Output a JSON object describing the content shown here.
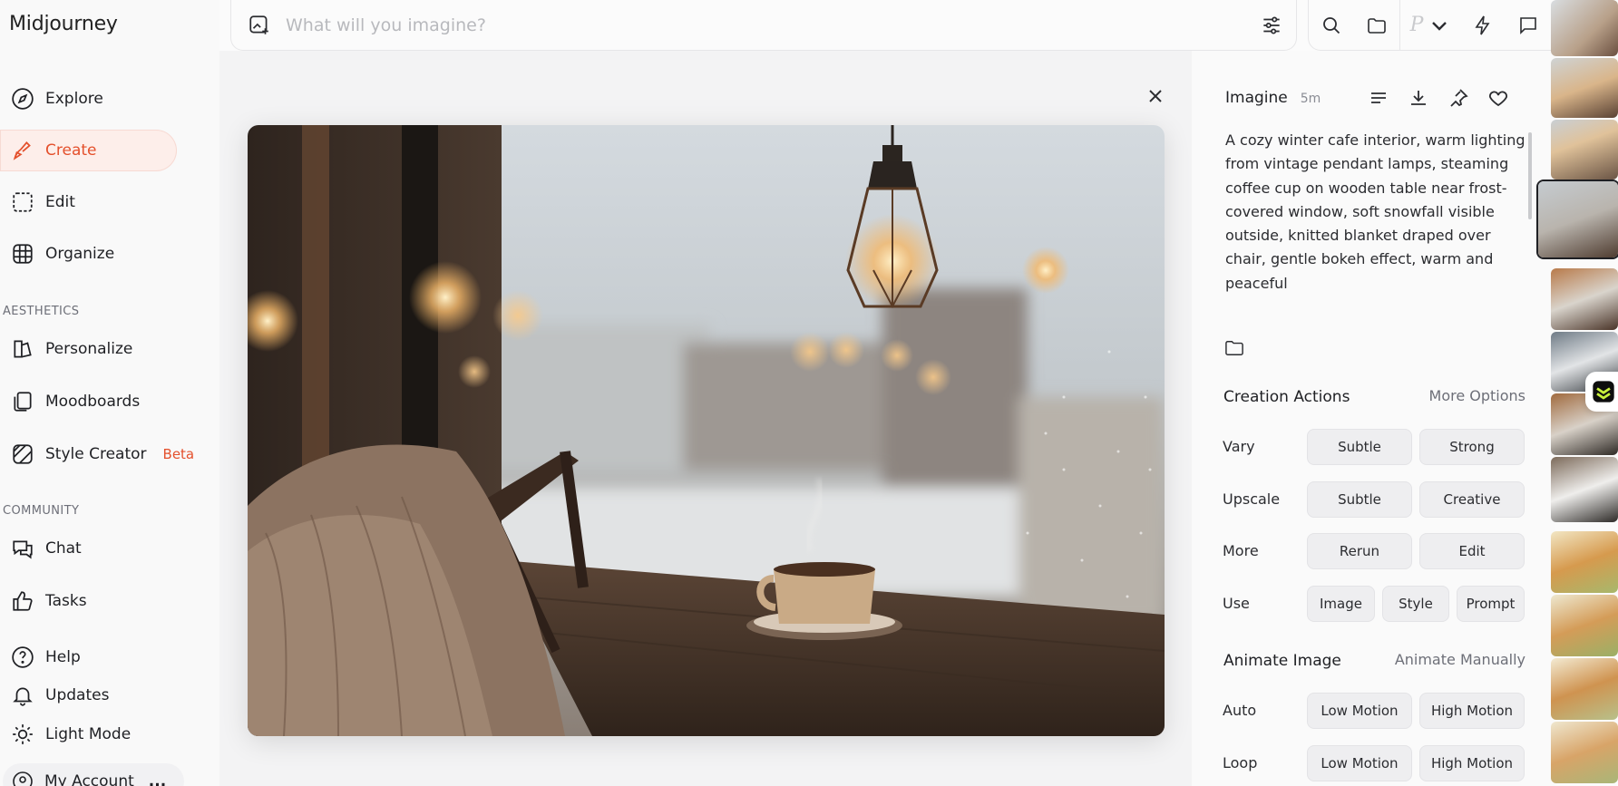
{
  "app": {
    "name": "Midjourney"
  },
  "sidebar": {
    "items": [
      {
        "label": "Explore",
        "icon": "compass-icon"
      },
      {
        "label": "Create",
        "icon": "brush-icon",
        "active": true
      },
      {
        "label": "Edit",
        "icon": "edit-selection-icon"
      },
      {
        "label": "Organize",
        "icon": "grid-icon"
      }
    ],
    "aesthetics_label": "AESTHETICS",
    "aesthetics_items": [
      {
        "label": "Personalize",
        "icon": "personalize-icon"
      },
      {
        "label": "Moodboards",
        "icon": "moodboards-icon"
      },
      {
        "label": "Style Creator",
        "icon": "style-creator-icon",
        "badge": "Beta"
      }
    ],
    "community_label": "COMMUNITY",
    "community_items": [
      {
        "label": "Chat",
        "icon": "chat-icon"
      },
      {
        "label": "Tasks",
        "icon": "thumbs-up-icon"
      }
    ],
    "bottom_items": [
      {
        "label": "Help",
        "icon": "help-icon"
      },
      {
        "label": "Updates",
        "icon": "bell-icon"
      },
      {
        "label": "Light Mode",
        "icon": "sun-icon"
      }
    ],
    "account_label": "My Account",
    "account_more": "..."
  },
  "search": {
    "placeholder": "What will you imagine?"
  },
  "topbar": {
    "profile_letter": "P"
  },
  "panel": {
    "title": "Imagine",
    "time": "5m",
    "prompt": "A cozy winter cafe interior, warm lighting from vintage pendant lamps, steaming coffee cup on wooden table near frost-covered window, soft snowfall visible outside, knitted blanket draped over chair, gentle bokeh effect, warm and peaceful",
    "creation_actions": {
      "title": "Creation Actions",
      "link": "More Options"
    },
    "rows": {
      "vary": {
        "label": "Vary",
        "buttons": [
          "Subtle",
          "Strong"
        ]
      },
      "upscale": {
        "label": "Upscale",
        "buttons": [
          "Subtle",
          "Creative"
        ]
      },
      "more": {
        "label": "More",
        "buttons": [
          "Rerun",
          "Edit"
        ]
      },
      "use": {
        "label": "Use",
        "buttons": [
          "Image",
          "Style",
          "Prompt"
        ]
      }
    },
    "animate": {
      "title": "Animate Image",
      "link": "Animate Manually"
    },
    "anim_rows": {
      "auto": {
        "label": "Auto",
        "buttons": [
          "Low Motion",
          "High Motion"
        ]
      },
      "loop": {
        "label": "Loop",
        "buttons": [
          "Low Motion",
          "High Motion"
        ]
      }
    }
  },
  "colors": {
    "accent": "#e4502c",
    "active_bg": "#fdeeea"
  }
}
